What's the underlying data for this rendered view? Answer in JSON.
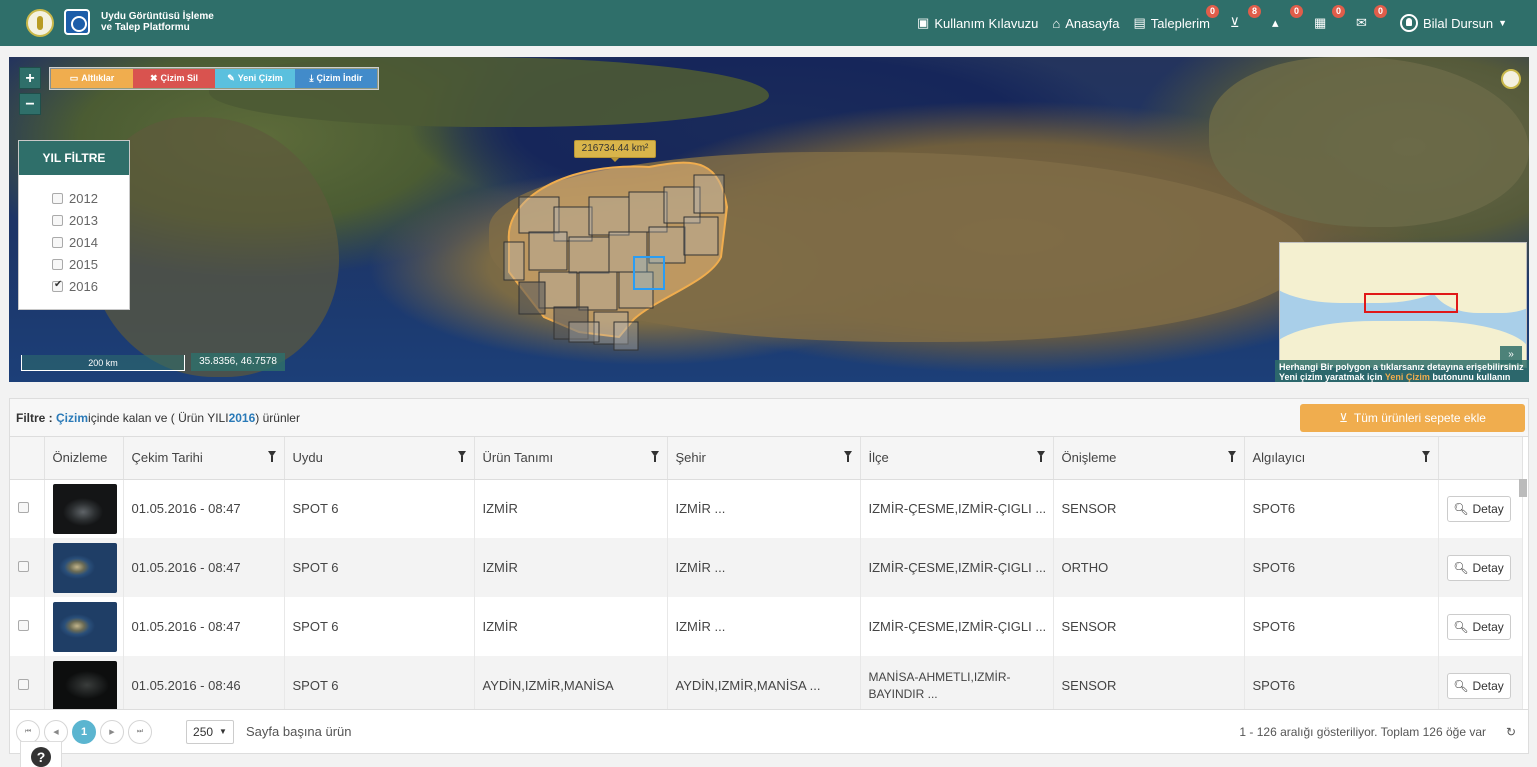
{
  "brand": {
    "line1": "Uydu Görüntüsü İşleme",
    "line2": "ve Talep Platformu"
  },
  "nav": {
    "guide": "Kullanım Kılavuzu",
    "home": "Anasayfa",
    "requests": "Taleplerim",
    "requests_badge": "0",
    "cart_badge": "8",
    "b3": "0",
    "b4": "0",
    "b5": "0",
    "user": "Bilal Dursun"
  },
  "map": {
    "toolbar": {
      "layers": "Altlıklar",
      "delete": "Çizim Sil",
      "new": "Yeni Çizim",
      "download": "Çizim İndir"
    },
    "year_filter": {
      "title": "YIL FİLTRE",
      "years": [
        {
          "label": "2012",
          "checked": false
        },
        {
          "label": "2013",
          "checked": false
        },
        {
          "label": "2014",
          "checked": false
        },
        {
          "label": "2015",
          "checked": false
        },
        {
          "label": "2016",
          "checked": true
        }
      ]
    },
    "area": "216734.44 km²",
    "scale": "200 km",
    "coords": "35.8356, 46.7578",
    "hint1": "Herhangi Bir polygon a tıklarsanız detayına erişebilirsiniz",
    "hint2_pre": "Yeni çizim yaratmak için ",
    "hint2_accent": "Yeni Çizim",
    "hint2_post": " butonunu kullanın"
  },
  "grid": {
    "filter_prefix": "Filtre :",
    "filter_draw": "Çizim",
    "filter_mid": " içinde kalan ve ( Ürün YILI ",
    "filter_year": "2016",
    "filter_suffix": " ) ürünler",
    "add_all": "Tüm ürünleri sepete ekle",
    "columns": [
      "Önizleme",
      "Çekim Tarihi",
      "Uydu",
      "Ürün Tanımı",
      "Şehir",
      "İlçe",
      "Önişleme",
      "Algılayıcı"
    ],
    "rows": [
      {
        "date": "01.05.2016 - 08:47",
        "sat": "SPOT 6",
        "product": "IZMİR",
        "city": "IZMİR ...",
        "district": "IZMİR-ÇESME,IZMİR-ÇIGLI ...",
        "pre": "SENSOR",
        "sensor": "SPOT6",
        "thumb": "dark"
      },
      {
        "date": "01.05.2016 - 08:47",
        "sat": "SPOT 6",
        "product": "IZMİR",
        "city": "IZMİR ...",
        "district": "IZMİR-ÇESME,IZMİR-ÇIGLI ...",
        "pre": "ORTHO",
        "sensor": "SPOT6",
        "thumb": "blue"
      },
      {
        "date": "01.05.2016 - 08:47",
        "sat": "SPOT 6",
        "product": "IZMİR",
        "city": "IZMİR ...",
        "district": "IZMİR-ÇESME,IZMİR-ÇIGLI ...",
        "pre": "SENSOR",
        "sensor": "SPOT6",
        "thumb": "blue"
      },
      {
        "date": "01.05.2016 - 08:46",
        "sat": "SPOT 6",
        "product": "AYDİN,IZMİR,MANİSA",
        "city": "AYDİN,IZMİR,MANİSA ...",
        "district": "MANİSA-AHMETLI,IZMİR-BAYINDIR ...",
        "pre": "SENSOR",
        "sensor": "SPOT6",
        "thumb": "black"
      }
    ],
    "detail": "Detay",
    "pager": {
      "page": "1",
      "page_size": "250",
      "page_size_label": "Sayfa başına ürün",
      "info": "1 - 126 aralığı gösteriliyor. Toplam 126 öğe var"
    }
  },
  "help": "?"
}
